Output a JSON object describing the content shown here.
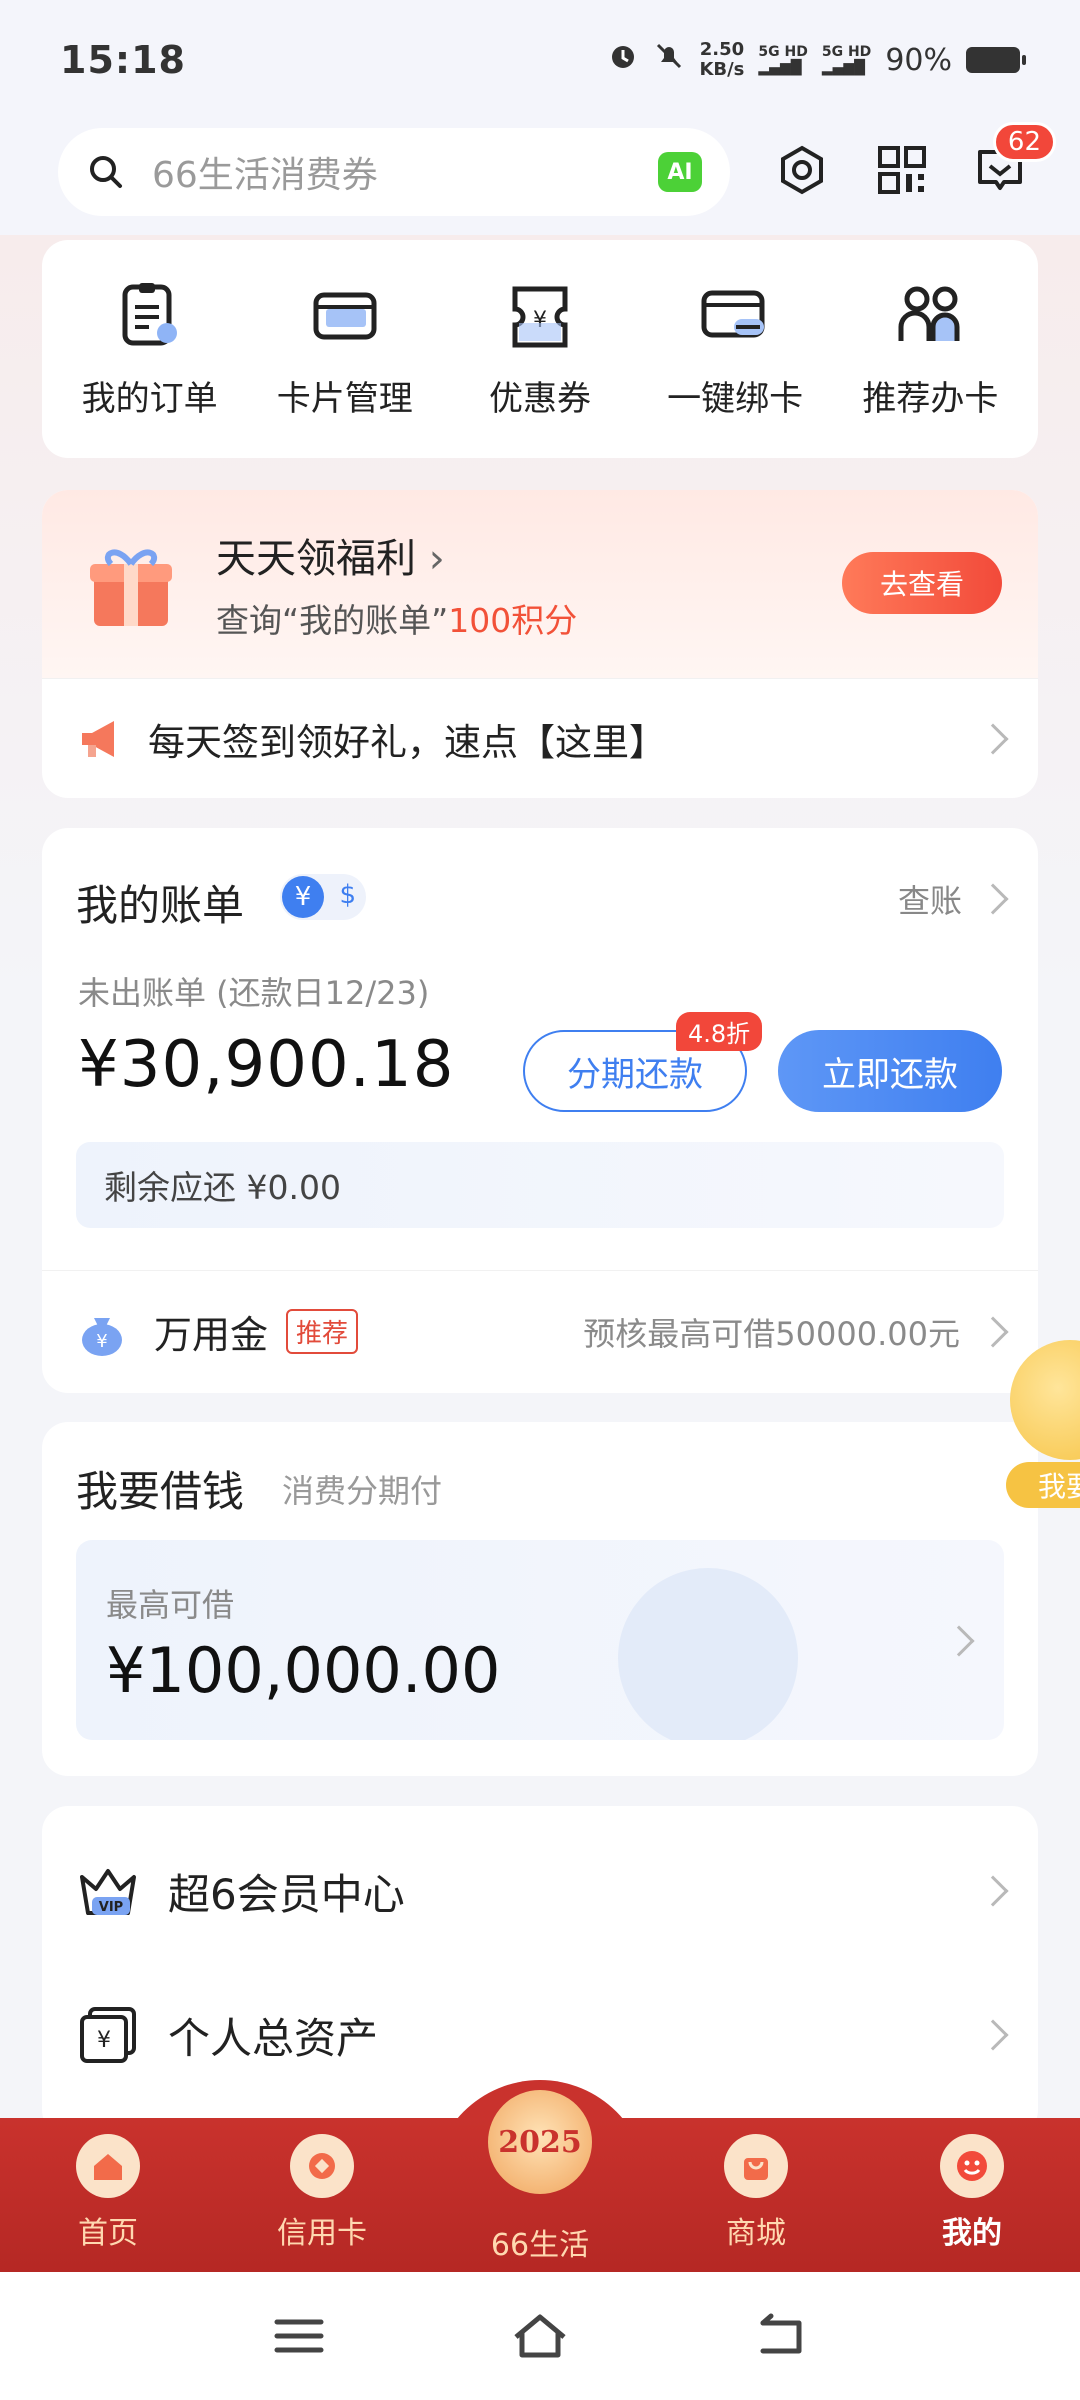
{
  "status": {
    "time": "15:18",
    "speed_value": "2.50",
    "speed_unit": "KB/s",
    "sig1": "5G HD",
    "sig2": "5G HD",
    "battery": "90%"
  },
  "header": {
    "search_placeholder": "66生活消费券",
    "ai_label": "AI",
    "message_count": "62"
  },
  "quick": [
    {
      "label": "我的订单",
      "icon": "order-icon"
    },
    {
      "label": "卡片管理",
      "icon": "card-manage-icon"
    },
    {
      "label": "优惠券",
      "icon": "coupon-icon"
    },
    {
      "label": "一键绑卡",
      "icon": "bind-card-icon"
    },
    {
      "label": "推荐办卡",
      "icon": "recommend-card-icon"
    }
  ],
  "welfare": {
    "title": "天天领福利",
    "sub_prefix": "查询“我的账单”",
    "sub_highlight": "100积分",
    "button": "去查看",
    "notice": "每天签到领好礼，速点【这里】"
  },
  "bill": {
    "title": "我的账单",
    "cur_yen": "¥",
    "cur_usd": "$",
    "check_label": "查账",
    "unbilled_label": "未出账单 (还款日12/23)",
    "amount": "¥30,900.18",
    "installment_label": "分期还款",
    "discount": "4.8折",
    "pay_label": "立即还款",
    "remaining": "剩余应还 ¥0.00",
    "loan_name": "万用金",
    "loan_tag": "推荐",
    "loan_info": "预核最高可借50000.00元"
  },
  "borrow": {
    "title": "我要借钱",
    "subtitle": "消费分期付",
    "max_label": "最高可借",
    "max_amount": "¥100,000.00"
  },
  "float_tag": "我要",
  "menu": [
    {
      "label": "超6会员中心",
      "icon": "vip-crown-icon"
    },
    {
      "label": "个人总资产",
      "icon": "assets-icon"
    }
  ],
  "tabs": [
    {
      "label": "首页",
      "icon": "home-icon"
    },
    {
      "label": "信用卡",
      "icon": "credit-card-icon"
    },
    {
      "label": "66生活",
      "icon": "66life-icon"
    },
    {
      "label": "商城",
      "icon": "mall-icon"
    },
    {
      "label": "我的",
      "icon": "profile-icon"
    }
  ],
  "tab_logo": "2025",
  "colors": {
    "brand_red": "#c9322d",
    "accent_blue": "#3f7ff0",
    "highlight_red": "#f25138"
  }
}
